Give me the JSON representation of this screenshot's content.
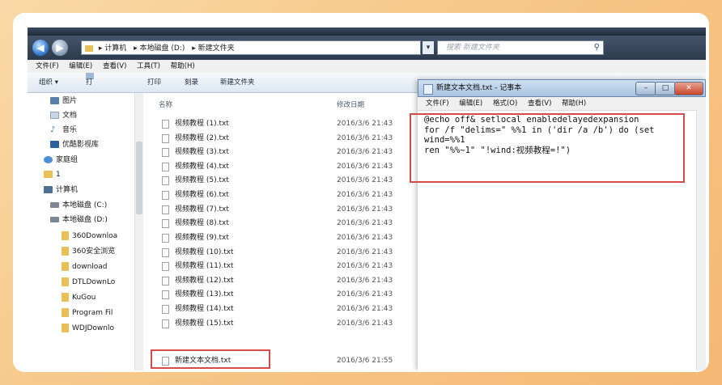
{
  "explorer": {
    "address": {
      "crumbs": [
        "计算机",
        "本地磁盘 (D:)",
        "新建文件夹"
      ],
      "search_placeholder": "搜索 新建文件夹"
    },
    "menu": [
      "文件(F)",
      "编辑(E)",
      "查看(V)",
      "工具(T)",
      "帮助(H)"
    ],
    "toolbar": [
      "组织 ▾",
      "打开 ▾",
      "打印",
      "刻录",
      "新建文件夹"
    ],
    "sidebar": [
      {
        "label": "图片",
        "icon": "pictures-icon",
        "color": "#5a7fa8"
      },
      {
        "label": "文档",
        "icon": "documents-icon",
        "color": "#c9d6e3"
      },
      {
        "label": "音乐",
        "icon": "music-icon",
        "color": "#3b7bbf"
      },
      {
        "label": "优酷影视库",
        "icon": "video-library-icon",
        "color": "#2f5f9e"
      },
      {
        "label": "家庭组",
        "icon": "homegroup-icon",
        "color": "#4c8fd6"
      },
      {
        "label": "1",
        "icon": "user-folder-icon",
        "color": "#e8c156"
      },
      {
        "label": "计算机",
        "icon": "computer-icon",
        "color": "#4f6f93"
      },
      {
        "label": "本地磁盘 (C:)",
        "icon": "drive-icon",
        "color": "#7d8894"
      },
      {
        "label": "本地磁盘 (D:)",
        "icon": "drive-icon",
        "color": "#7d8894"
      },
      {
        "label": "360Downloa",
        "icon": "folder-icon",
        "color": "#e8c156"
      },
      {
        "label": "360安全浏览",
        "icon": "folder-icon",
        "color": "#e8c156"
      },
      {
        "label": "download",
        "icon": "folder-icon",
        "color": "#e8c156"
      },
      {
        "label": "DTLDownLo",
        "icon": "folder-icon",
        "color": "#e8c156"
      },
      {
        "label": "KuGou",
        "icon": "folder-icon",
        "color": "#e8c156"
      },
      {
        "label": "Program Fil",
        "icon": "folder-icon",
        "color": "#e8c156"
      },
      {
        "label": "WDJDownlo",
        "icon": "folder-icon",
        "color": "#e8c156"
      }
    ],
    "columns": {
      "name": "名称",
      "date": "修改日期"
    },
    "files": [
      {
        "name": "视频教程 (1).txt",
        "date": "2016/3/6 21:43"
      },
      {
        "name": "视频教程 (2).txt",
        "date": "2016/3/6 21:43"
      },
      {
        "name": "视频教程 (3).txt",
        "date": "2016/3/6 21:43"
      },
      {
        "name": "视频教程 (4).txt",
        "date": "2016/3/6 21:43"
      },
      {
        "name": "视频教程 (5).txt",
        "date": "2016/3/6 21:43"
      },
      {
        "name": "视频教程 (6).txt",
        "date": "2016/3/6 21:43"
      },
      {
        "name": "视频教程 (7).txt",
        "date": "2016/3/6 21:43"
      },
      {
        "name": "视频教程 (8).txt",
        "date": "2016/3/6 21:43"
      },
      {
        "name": "视频教程 (9).txt",
        "date": "2016/3/6 21:43"
      },
      {
        "name": "视频教程 (10).txt",
        "date": "2016/3/6 21:43"
      },
      {
        "name": "视频教程 (11).txt",
        "date": "2016/3/6 21:43"
      },
      {
        "name": "视频教程 (12).txt",
        "date": "2016/3/6 21:43"
      },
      {
        "name": "视频教程 (13).txt",
        "date": "2016/3/6 21:43"
      },
      {
        "name": "视频教程 (14).txt",
        "date": "2016/3/6 21:43"
      },
      {
        "name": "视频教程 (15).txt",
        "date": "2016/3/6 21:43"
      },
      {
        "name": "新建文本文档.txt",
        "date": "2016/3/6 21:55"
      }
    ]
  },
  "notepad": {
    "title": "新建文本文档.txt - 记事本",
    "menu": [
      "文件(F)",
      "编辑(E)",
      "格式(O)",
      "查看(V)",
      "帮助(H)"
    ],
    "lines": [
      "@echo off& setlocal enabledelayedexpansion",
      "for /f \"delims=\" %%1 in ('dir /a /b') do (set",
      "wind=%%1",
      "ren \"%%~1\" \"!wind:视频教程=!\")"
    ]
  }
}
